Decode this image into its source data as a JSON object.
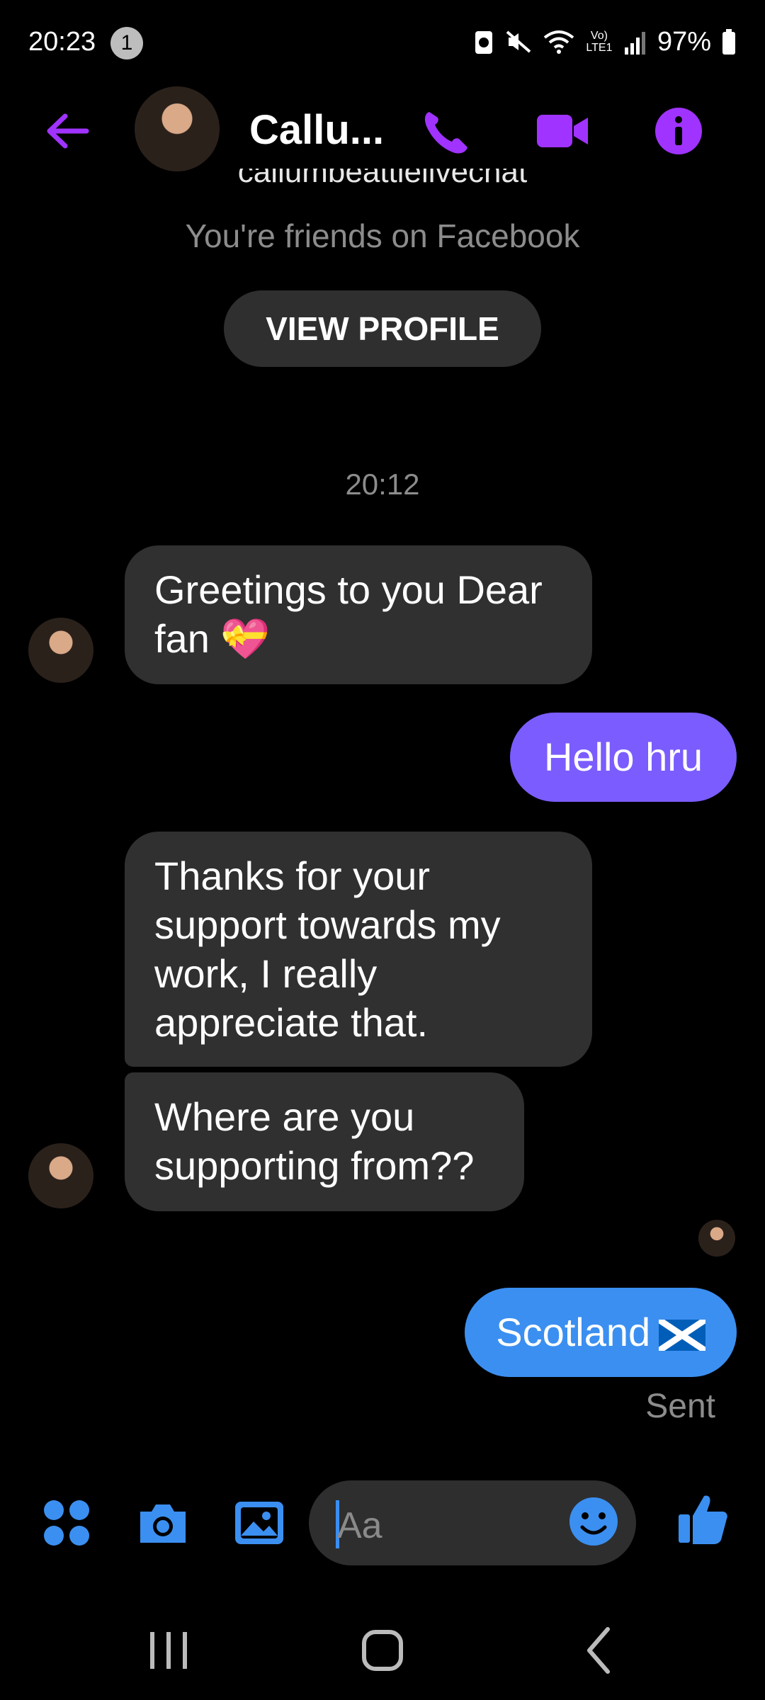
{
  "status_bar": {
    "time": "20:23",
    "notification_count": "1",
    "battery": "97%",
    "network_label": "Vo) LTE1"
  },
  "header": {
    "contact_name": "Callu...",
    "icons": [
      "back-arrow-icon",
      "phone-icon",
      "video-camera-icon",
      "info-icon"
    ],
    "accent_color": "#a033ff"
  },
  "profile_intro": {
    "username_clipped": "callumbeattielivechat",
    "friends_text": "You're friends on Facebook",
    "view_profile_label": "VIEW PROFILE"
  },
  "conversation": {
    "timestamp": "20:12",
    "messages": [
      {
        "direction": "in",
        "text": "Greetings to you Dear fan 💝"
      },
      {
        "direction": "out",
        "text": "Hello hru",
        "color": "#7b5cff"
      },
      {
        "direction": "in",
        "text": "Thanks for your support towards my work, I really appreciate that."
      },
      {
        "direction": "in",
        "text": "Where are you supporting from??"
      },
      {
        "direction": "out",
        "text": "Scotland",
        "color": "#3b8ff0"
      }
    ],
    "status": "Sent"
  },
  "composer": {
    "placeholder": "Aa",
    "icons": [
      "apps-grid-icon",
      "camera-icon",
      "gallery-icon",
      "emoji-icon",
      "thumbs-up-icon"
    ],
    "accent_color": "#3b8ff0"
  },
  "nav_bar": {
    "icons": [
      "recents-icon",
      "home-icon",
      "back-icon"
    ]
  }
}
